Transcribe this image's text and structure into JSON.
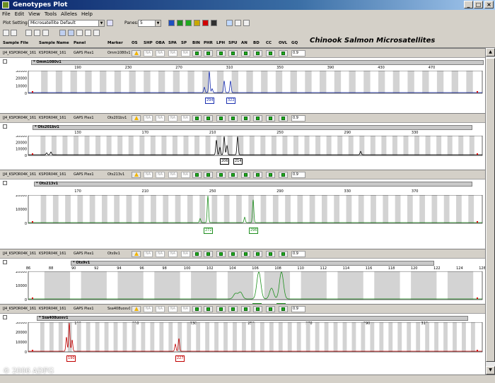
{
  "window": {
    "title": "Genotypes Plot",
    "minimize": "_",
    "maximize": "□",
    "close": "×"
  },
  "menu": [
    "File",
    "Edit",
    "View",
    "Tools",
    "Alleles",
    "Help"
  ],
  "toolbar": {
    "plot_setting_label": "Plot Setting:",
    "plot_setting_value": "Microsatellite Default",
    "panes_label": "Panes:",
    "panes_value": "5",
    "color_buttons": [
      "#1f4fbf",
      "#1f8f1f",
      "#1faa1f",
      "#c8a800",
      "#d00000",
      "#303030"
    ]
  },
  "heading": "Chinook Salmon Microsatellites",
  "columns": [
    "Sample File",
    "Sample Name",
    "Panel",
    "Marker",
    "OS",
    "SHP",
    "OBA",
    "SPA",
    "SP",
    "BIN",
    "PHR",
    "LPH",
    "SPU",
    "AN",
    "BD",
    "CC",
    "OVL",
    "GQ"
  ],
  "panels": [
    {
      "sample_file": "JJ4_KSPOR04K_161",
      "sample_name": "KSPOR04K_161",
      "panel": "GAPS Plex1",
      "marker": "Omm1080v1",
      "gq": "0.9",
      "locus": "* Omm1080v1",
      "color": "#1a2fb0",
      "ticks": [
        "190",
        "230",
        "270",
        "310",
        "350",
        "390",
        "430",
        "470"
      ],
      "yticks": [
        "30000",
        "20000",
        "10000",
        "0"
      ],
      "alleles": [
        "294",
        "322"
      ],
      "bins": 30
    },
    {
      "sample_file": "JJ4_KSPOR04K_161",
      "sample_name": "KSPOR04K_161",
      "panel": "GAPS Plex1",
      "marker": "Ots201bv1",
      "gq": "0.9",
      "locus": "* Ots201bv1",
      "color": "#000000",
      "ticks": [
        "130",
        "170",
        "210",
        "250",
        "290",
        "330"
      ],
      "yticks": [
        "30000",
        "20000",
        "10000",
        "0"
      ],
      "alleles": [
        "206",
        "214"
      ],
      "bins": 40
    },
    {
      "sample_file": "JJ4_KSPOR04K_161",
      "sample_name": "KSPOR04K_161",
      "panel": "GAPS Plex1",
      "marker": "Ots213v1",
      "gq": "0.9",
      "locus": "* Ots213v1",
      "color": "#1f8f1f",
      "ticks": [
        "170",
        "210",
        "250",
        "290",
        "330",
        "370"
      ],
      "yticks": [
        "20000",
        "10000",
        "0"
      ],
      "alleles": [
        "272",
        "296"
      ],
      "bins": 36
    },
    {
      "sample_file": "JJ4_KSPOR04K_161",
      "sample_name": "KSPOR04K_161",
      "panel": "GAPS Plex1",
      "marker": "Ots9v1",
      "gq": "0.9",
      "locus": "* Ots9v1",
      "color": "#1f8f1f",
      "ticks": [
        "86",
        "88",
        "90",
        "92",
        "94",
        "96",
        "98",
        "100",
        "102",
        "104",
        "106",
        "108",
        "110",
        "112",
        "114",
        "116",
        "118",
        "120",
        "122",
        "124",
        "126"
      ],
      "yticks": [
        "20000",
        "10000",
        "0"
      ],
      "alleles": [
        "104",
        "108"
      ],
      "bins": 12
    },
    {
      "sample_file": "JJ4_KSPOR04K_161",
      "sample_name": "KSPOR04K_161",
      "panel": "GAPS Plex1",
      "marker": "Ssa408uosv1",
      "gq": "0.9",
      "locus": "* Ssa408uosv1",
      "color": "#c00000",
      "ticks": [
        "190",
        "210",
        "230",
        "250",
        "270",
        "290",
        "310"
      ],
      "yticks": [
        "30000",
        "20000",
        "10000",
        "0"
      ],
      "alleles": [
        "190",
        "227"
      ],
      "bins": 48
    }
  ],
  "na_text": "NA",
  "copyright": "© 2006 ADFG"
}
